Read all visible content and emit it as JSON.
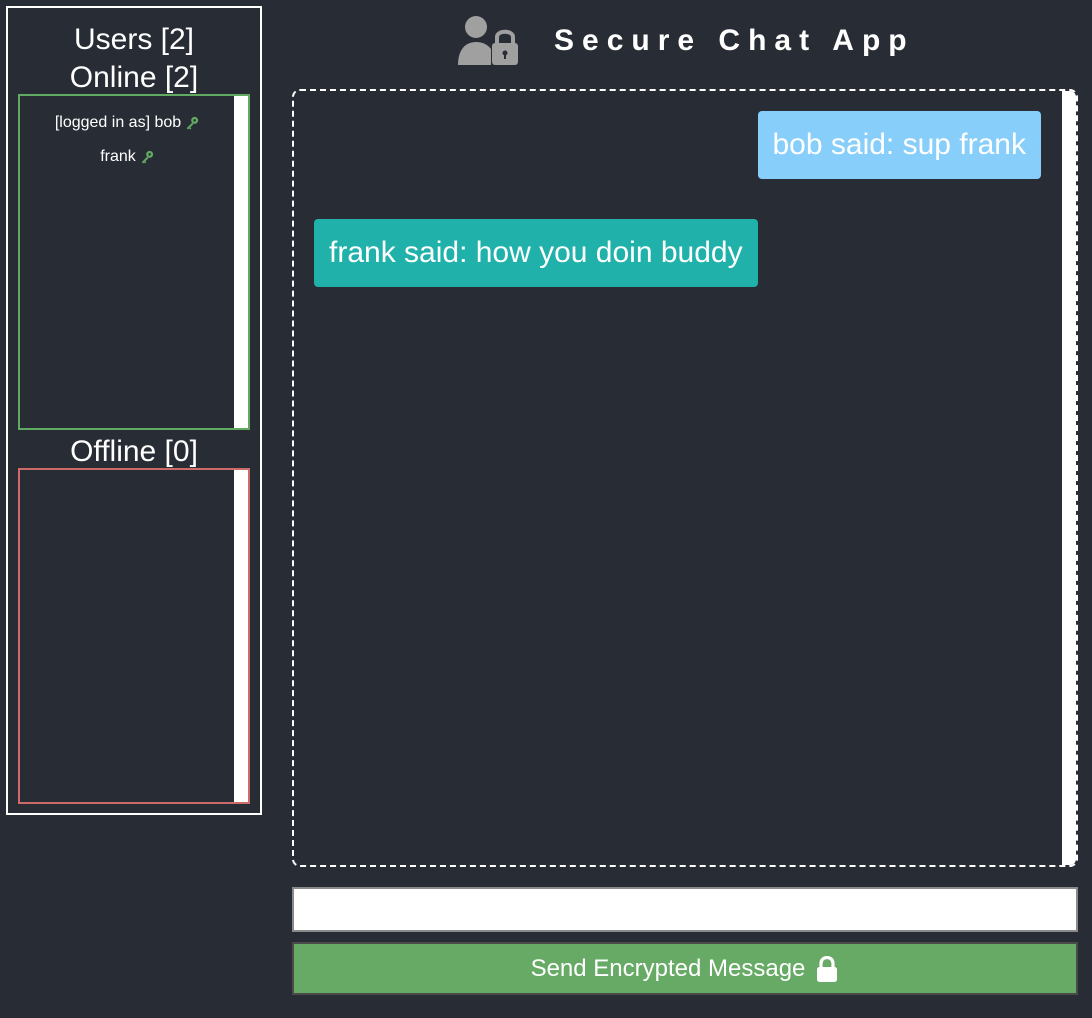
{
  "app": {
    "title": "Secure Chat App"
  },
  "sidebar": {
    "users_heading": "Users [2]",
    "online_heading": "Online [2]",
    "offline_heading": "Offline [0]",
    "online_users": [
      {
        "label": "[logged in as] bob",
        "icon": "key-icon"
      },
      {
        "label": "frank",
        "icon": "key-icon"
      }
    ],
    "offline_users": []
  },
  "chat": {
    "messages": [
      {
        "text": "bob said: sup frank",
        "from": "me",
        "color": "#87cefa"
      },
      {
        "text": "frank said: how you doin buddy",
        "from": "other",
        "color": "#20b2aa"
      }
    ]
  },
  "composer": {
    "input_value": "",
    "input_placeholder": "",
    "send_label": "Send Encrypted Message",
    "send_icon": "lock-icon",
    "send_color": "#66aa66"
  },
  "colors": {
    "background": "#282c34",
    "online_border": "#62a962",
    "offline_border": "#cd6b6b",
    "key_icon": "#62a962"
  }
}
